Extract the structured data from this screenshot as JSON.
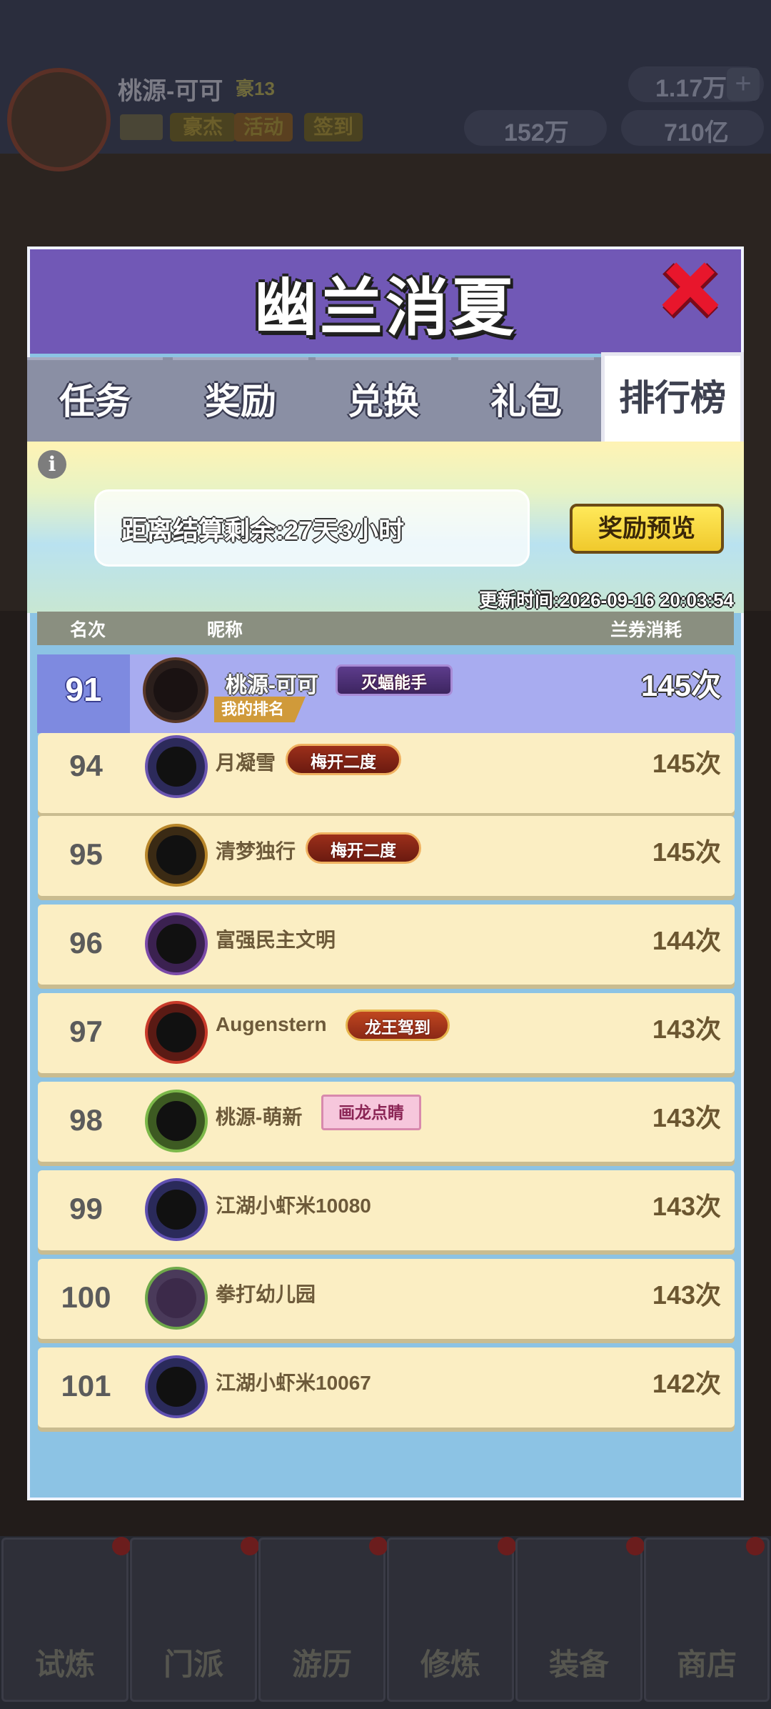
{
  "background_hud": {
    "player_name": "桃源-可可",
    "player_level": "豪13",
    "chips": [
      "豪杰",
      "活动",
      "签到"
    ],
    "gems": "1.17万",
    "coupons": "152万",
    "gold": "710亿",
    "nav": [
      "试炼",
      "门派",
      "游历",
      "修炼",
      "装备",
      "商店"
    ]
  },
  "modal": {
    "title": "幽兰消夏",
    "tabs": [
      "任务",
      "奖励",
      "兑换",
      "礼包",
      "排行榜"
    ],
    "active_tab": "排行榜",
    "countdown": "距离结算剩余:27天3小时",
    "preview_button": "奖励预览",
    "update_time": "更新时间:2026-09-16 20:03:54",
    "columns": {
      "rank": "名次",
      "nickname": "昵称",
      "spent": "兰券消耗"
    }
  },
  "my_entry": {
    "rank": "91",
    "name": "桃源-可可",
    "badge": "灭蝠能手",
    "label": "我的排名",
    "score": "145次"
  },
  "rows": [
    {
      "rank": "94",
      "name": "月凝雪",
      "badge": "梅开二度",
      "score": "145次"
    },
    {
      "rank": "95",
      "name": "清梦独行",
      "badge": "梅开二度",
      "score": "145次"
    },
    {
      "rank": "96",
      "name": "富强民主文明",
      "badge": "",
      "score": "144次"
    },
    {
      "rank": "97",
      "name": "Augenstern",
      "badge": "龙王驾到",
      "score": "143次"
    },
    {
      "rank": "98",
      "name": "桃源-萌新",
      "badge": "画龙点睛",
      "score": "143次"
    },
    {
      "rank": "99",
      "name": "江湖小虾米10080",
      "badge": "",
      "score": "143次"
    },
    {
      "rank": "100",
      "name": "拳打幼儿园",
      "badge": "",
      "score": "143次"
    },
    {
      "rank": "101",
      "name": "江湖小虾米10067",
      "badge": "",
      "score": "142次"
    }
  ],
  "colors": {
    "header_purple": "#7158b6",
    "row_cream": "#fbeec3",
    "my_row": "#a8acf0",
    "preview_button": "#ffe95a"
  }
}
